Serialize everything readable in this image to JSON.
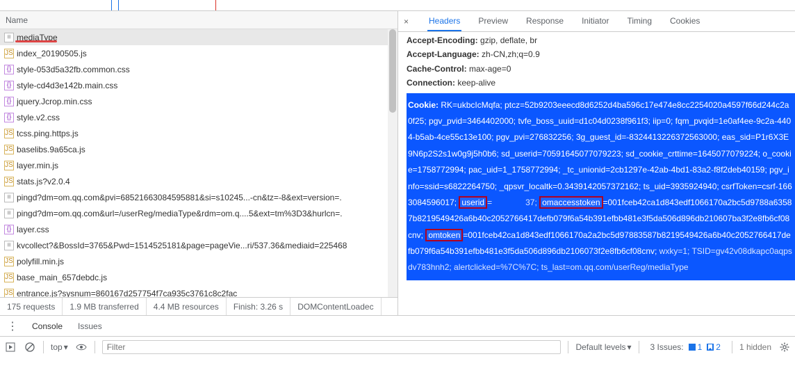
{
  "top": {},
  "network": {
    "column_header": "Name",
    "rows": [
      {
        "icon": "doc",
        "name": "mediaType",
        "selected": true,
        "underline": true
      },
      {
        "icon": "js",
        "name": "index_20190505.js"
      },
      {
        "icon": "css",
        "name": "style-053d5a32fb.common.css"
      },
      {
        "icon": "css",
        "name": "style-cd4d3e142b.main.css"
      },
      {
        "icon": "css",
        "name": "jquery.Jcrop.min.css"
      },
      {
        "icon": "css",
        "name": "style.v2.css"
      },
      {
        "icon": "js",
        "name": "tcss.ping.https.js"
      },
      {
        "icon": "js",
        "name": "baselibs.9a65ca.js"
      },
      {
        "icon": "js",
        "name": "layer.min.js"
      },
      {
        "icon": "js",
        "name": "stats.js?v2.0.4"
      },
      {
        "icon": "doc",
        "name": "pingd?dm=om.qq.com&pvi=68521663084595881&si=s10245...-cn&tz=-8&ext=version=."
      },
      {
        "icon": "doc",
        "name": "pingd?dm=om.qq.com&url=/userReg/mediaType&rdm=om.q....5&ext=tm%3D3&hurlcn=."
      },
      {
        "icon": "css",
        "name": "layer.css"
      },
      {
        "icon": "doc",
        "name": "kvcollect?&BossId=3765&Pwd=1514525181&page=pageVie...ri/537.36&mediaid=225468"
      },
      {
        "icon": "js",
        "name": "polyfill.min.js"
      },
      {
        "icon": "js",
        "name": "base_main_657debdc.js"
      },
      {
        "icon": "js",
        "name": "entrance.js?sysnum=860167d257754f7ca935c3761c8c2fac"
      }
    ],
    "status": {
      "requests": "175 requests",
      "transferred": "1.9 MB transferred",
      "resources": "4.4 MB resources",
      "finish": "Finish: 3.26 s",
      "dcl": "DOMContentLoadec"
    }
  },
  "details": {
    "tabs": [
      "Headers",
      "Preview",
      "Response",
      "Initiator",
      "Timing",
      "Cookies"
    ],
    "active_tab": "Headers",
    "simple": [
      {
        "k": "Accept-Encoding:",
        "v": "gzip, deflate, br"
      },
      {
        "k": "Accept-Language:",
        "v": "zh-CN,zh;q=0.9"
      },
      {
        "k": "Cache-Control:",
        "v": "max-age=0"
      },
      {
        "k": "Connection:",
        "v": "keep-alive"
      }
    ],
    "cookie_label": "Cookie:",
    "cookie_pre": " RK=ukbcIcMqfa; ptcz=52b9203eeecd8d6252d4ba596c17e474e8cc2254020a4597f66d244c2a0f25; pgv_pvid=3464402000; tvfe_boss_uuid=d1c04d0238f961f3; iip=0; fqm_pvqid=1e0af4ee-9c2a-4404-b5ab-4ce55c13e100; pgv_pvi=276832256; 3g_guest_id=-8324413226372563000; eas_sid=P1r6X3E9N6p2S2s1w0g9j5h0b6; sd_userid=70591645077079223; sd_cookie_crttime=1645077079224; o_cookie=1758772994; pac_uid=1_1758772994; _tc_unionid=2cb1297e-42ab-4bd1-83a2-f8f2deb40159; pgv_info=ssid=s6822264750; _qpsvr_localtk=0.3439142057372162; ts_uid=3935924940; csrfToken=csrf-1663084596017; ",
    "userid_label": "userid",
    "userid_value": "37; ",
    "omaccesstoken_label": "omaccesstoken",
    "cookie_mid1": "=001fceb42ca1d843edf1066170a2bc5d9788a63587b8219549426a6b40c2052766417defb079f6a54b391efbb481e3f5da506d896db210607ba3f2e8fb6cf08cnv; ",
    "omtoken_label": "omtoken",
    "cookie_mid2": "=001fceb42ca1d843edf1066170a2a2bc5d97883587b8219549426a6b40c2052766417defb079f6a54b391efbb481e3f5da506d896db2106073f2e8fb6cf08cnv;",
    "cookie_post": " wxky=1; TSID=gv42v08dkapc0aqpsdv783hnh2; alertclicked=%7C%7C; ts_last=om.qq.com/userReg/mediaType"
  },
  "drawer": {
    "tabs": [
      "Console",
      "Issues"
    ],
    "active": "Console"
  },
  "filter": {
    "top_label": "top",
    "placeholder": "Filter",
    "levels_label": "Default levels",
    "issues_label": "3 Issues:",
    "issues_blue_n": "1",
    "issues_blue2_n": "2",
    "hidden_label": "1 hidden"
  }
}
